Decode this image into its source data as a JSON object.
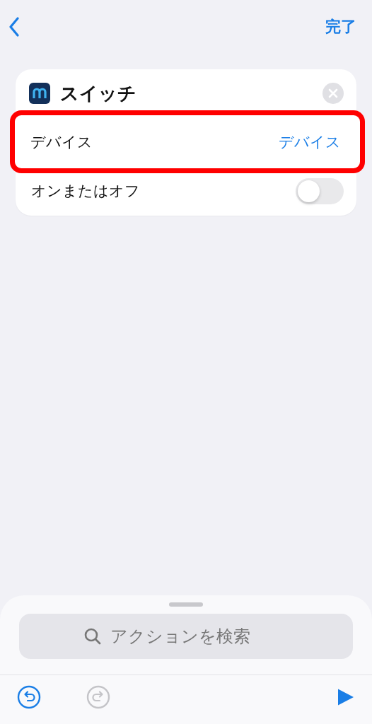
{
  "nav": {
    "done": "完了"
  },
  "action": {
    "title": "スイッチ",
    "params": [
      {
        "kind": "value",
        "label": "デバイス",
        "value": "デバイス",
        "highlighted": true
      },
      {
        "kind": "toggle",
        "label": "オンまたはオフ",
        "on": false,
        "highlighted": false
      }
    ]
  },
  "search": {
    "placeholder": "アクションを検索"
  },
  "toolbar": {
    "undo_disabled": false,
    "redo_disabled": true
  }
}
